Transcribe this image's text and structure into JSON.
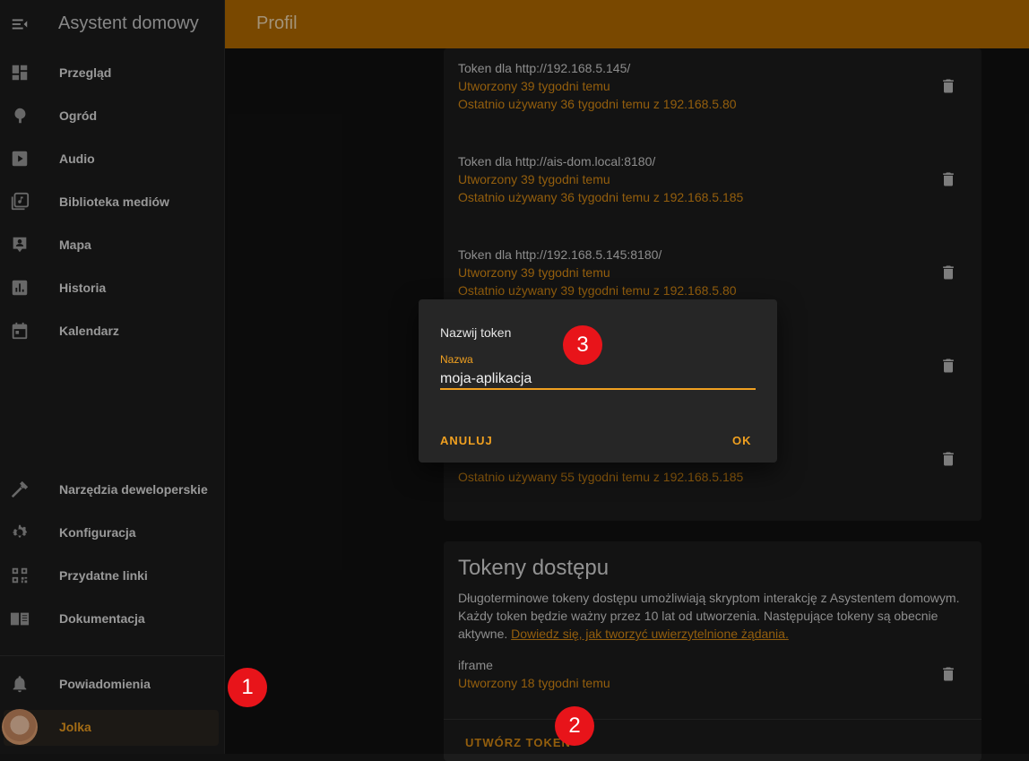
{
  "app": {
    "title": "Asystent domowy"
  },
  "topbar": {
    "title": "Profil"
  },
  "sidebar": {
    "items": [
      {
        "label": "Przegląd",
        "icon": "dashboard-icon"
      },
      {
        "label": "Ogród",
        "icon": "tree-icon"
      },
      {
        "label": "Audio",
        "icon": "play-icon"
      },
      {
        "label": "Biblioteka mediów",
        "icon": "media-library-icon"
      },
      {
        "label": "Mapa",
        "icon": "map-account-icon"
      },
      {
        "label": "Historia",
        "icon": "history-chart-icon"
      },
      {
        "label": "Kalendarz",
        "icon": "calendar-icon"
      }
    ],
    "bottom_items": [
      {
        "label": "Narzędzia deweloperskie",
        "icon": "hammer-icon"
      },
      {
        "label": "Konfiguracja",
        "icon": "gear-icon"
      },
      {
        "label": "Przydatne linki",
        "icon": "qrcode-icon"
      },
      {
        "label": "Dokumentacja",
        "icon": "book-icon"
      }
    ],
    "notifications": {
      "label": "Powiadomienia",
      "icon": "bell-icon"
    },
    "user": {
      "label": "Jolka"
    }
  },
  "refresh_tokens": [
    {
      "title": "Token dla http://192.168.5.145/",
      "created": "Utworzony 39 tygodni temu",
      "last_used": "Ostatnio używany 36 tygodni temu z 192.168.5.80"
    },
    {
      "title": "Token dla http://ais-dom.local:8180/",
      "created": "Utworzony 39 tygodni temu",
      "last_used": "Ostatnio używany 36 tygodni temu z 192.168.5.185"
    },
    {
      "title": "Token dla http://192.168.5.145:8180/",
      "created": "Utworzony 39 tygodni temu",
      "last_used": "Ostatnio używany 39 tygodni temu z 192.168.5.80"
    },
    {
      "title": "",
      "created": "",
      "last_used": ""
    },
    {
      "title": "",
      "created": "",
      "last_used": "Ostatnio używany 55 tygodni temu z 192.168.5.185"
    }
  ],
  "access_tokens": {
    "heading": "Tokeny dostępu",
    "description": "Długoterminowe tokeny dostępu umożliwiają skryptom interakcję z Asystentem domowym. Każdy token będzie ważny przez 10 lat od utworzenia. Następujące tokeny są obecnie aktywne.",
    "link": "Dowiedz się, jak tworzyć uwierzytelnione żądania.",
    "items": [
      {
        "name": "iframe",
        "created": "Utworzony 18 tygodni temu"
      }
    ],
    "create_button": "UTWÓRZ TOKEN"
  },
  "dialog": {
    "title": "Nazwij token",
    "field_label": "Nazwa",
    "field_value": "moja-aplikacja",
    "cancel": "ANULUJ",
    "ok": "OK"
  },
  "badges": [
    "1",
    "2",
    "3"
  ],
  "colors": {
    "accent": "#f0a020",
    "topbar": "#b36a00",
    "badge": "#e8141a"
  }
}
